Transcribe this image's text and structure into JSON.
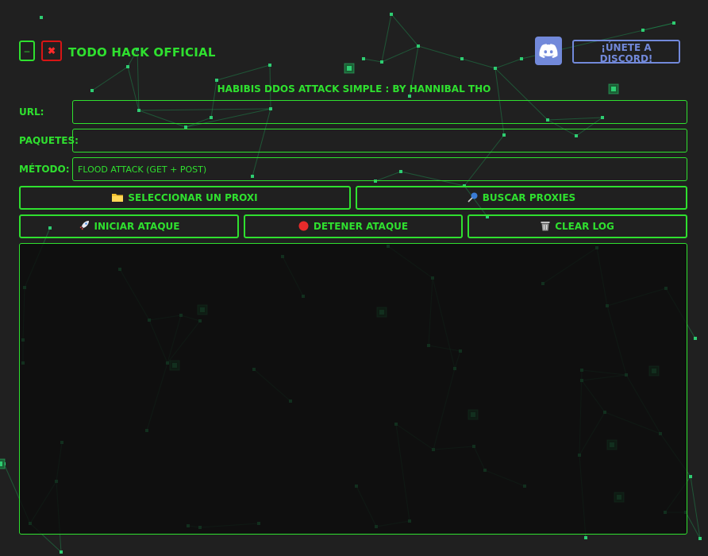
{
  "window": {
    "minimize_label": "–",
    "close_label": "✖",
    "title": "TODO HACK OFFICIAL"
  },
  "discord": {
    "icon": "discord-icon",
    "button_label": "¡ÚNETE A DISCORD!",
    "color": "#7289da"
  },
  "subtitle": "HABIBIS DDOS ATTACK SIMPLE : BY HANNIBAL THO",
  "form": {
    "url_label": "URL:",
    "url_value": "",
    "packets_label": "PAQUETES:",
    "packets_value": "",
    "method_label": "MÉTODO:",
    "method_value": "FLOOD ATTACK (GET + POST)"
  },
  "buttons": {
    "select_proxy": {
      "label": "SELECCIONAR UN PROXI",
      "icon": "folder-icon"
    },
    "search_proxies": {
      "label": "BUSCAR PROXIES",
      "icon": "pin-icon"
    },
    "start_attack": {
      "label": "INICIAR ATAQUE",
      "icon": "rocket-icon"
    },
    "stop_attack": {
      "label": "DETENER ATAQUE",
      "icon": "stop-icon"
    },
    "clear_log": {
      "label": "CLEAR LOG",
      "icon": "trash-icon"
    }
  },
  "log": {
    "value": ""
  },
  "colors": {
    "accent": "#2fe02f",
    "background": "#202020",
    "close": "#d71515",
    "network": "#1f9a55"
  }
}
